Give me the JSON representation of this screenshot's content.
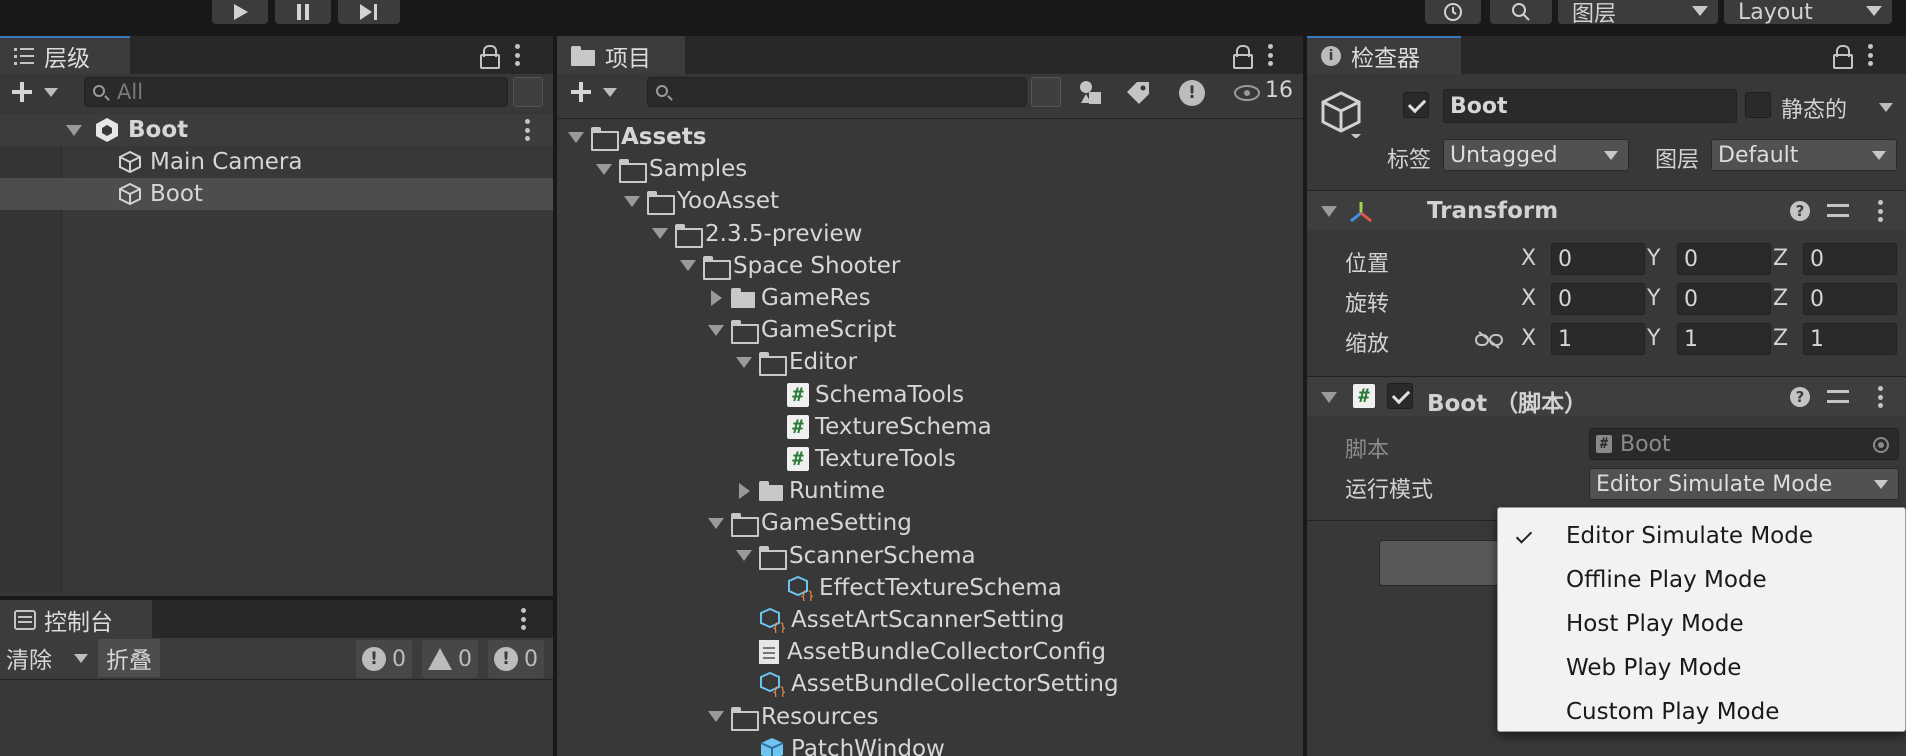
{
  "toolbar": {
    "layers_label": "图层",
    "layout_label": "Layout"
  },
  "hierarchy": {
    "tab_label": "层级",
    "search_placeholder": "All",
    "items": [
      {
        "label": "Boot",
        "level": 0
      },
      {
        "label": "Main Camera",
        "level": 1
      },
      {
        "label": "Boot",
        "level": 1
      }
    ]
  },
  "project": {
    "tab_label": "项目",
    "hidden_count": "16",
    "tree": [
      {
        "label": "Assets",
        "level": 0,
        "type": "folder-open",
        "bold": true
      },
      {
        "label": "Samples",
        "level": 1,
        "type": "folder-open"
      },
      {
        "label": "YooAsset",
        "level": 2,
        "type": "folder-open"
      },
      {
        "label": "2.3.5-preview",
        "level": 3,
        "type": "folder-open"
      },
      {
        "label": "Space Shooter",
        "level": 4,
        "type": "folder-open"
      },
      {
        "label": "GameRes",
        "level": 5,
        "type": "folder-closed"
      },
      {
        "label": "GameScript",
        "level": 5,
        "type": "folder-open"
      },
      {
        "label": "Editor",
        "level": 6,
        "type": "folder-open"
      },
      {
        "label": "SchemaTools",
        "level": 7,
        "type": "script"
      },
      {
        "label": "TextureSchema",
        "level": 7,
        "type": "script"
      },
      {
        "label": "TextureTools",
        "level": 7,
        "type": "script"
      },
      {
        "label": "Runtime",
        "level": 6,
        "type": "folder-closed"
      },
      {
        "label": "GameSetting",
        "level": 5,
        "type": "folder-open"
      },
      {
        "label": "ScannerSchema",
        "level": 6,
        "type": "folder-open"
      },
      {
        "label": "EffectTextureSchema",
        "level": 7,
        "type": "scriptable"
      },
      {
        "label": "AssetArtScannerSetting",
        "level": 6,
        "type": "scriptable"
      },
      {
        "label": "AssetBundleCollectorConfig",
        "level": 6,
        "type": "document"
      },
      {
        "label": "AssetBundleCollectorSetting",
        "level": 6,
        "type": "scriptable"
      },
      {
        "label": "Resources",
        "level": 5,
        "type": "folder-open"
      },
      {
        "label": "PatchWindow",
        "level": 6,
        "type": "prefab"
      }
    ]
  },
  "console": {
    "tab_label": "控制台",
    "clear_label": "清除",
    "collapse_label": "折叠",
    "info_count": "0",
    "warning_count": "0",
    "error_count": "0"
  },
  "inspector": {
    "tab_label": "检查器",
    "object_name": "Boot",
    "static_label": "静态的",
    "tag_label": "标签",
    "tag_value": "Untagged",
    "layer_label": "图层",
    "layer_value": "Default",
    "transform": {
      "title": "Transform",
      "position_label": "位置",
      "rotation_label": "旋转",
      "scale_label": "缩放",
      "axis_x": "X",
      "axis_y": "Y",
      "axis_z": "Z",
      "position": [
        "0",
        "0",
        "0"
      ],
      "rotation": [
        "0",
        "0",
        "0"
      ],
      "scale": [
        "1",
        "1",
        "1"
      ]
    },
    "script_component": {
      "title": "Boot （脚本）",
      "script_label": "脚本",
      "script_value": "Boot",
      "play_mode_label": "运行模式",
      "play_mode_value": "Editor Simulate Mode"
    }
  },
  "play_mode_menu": {
    "options": [
      "Editor Simulate Mode",
      "Offline Play Mode",
      "Host Play Mode",
      "Web Play Mode",
      "Custom Play Mode"
    ],
    "selected_index": 0
  }
}
